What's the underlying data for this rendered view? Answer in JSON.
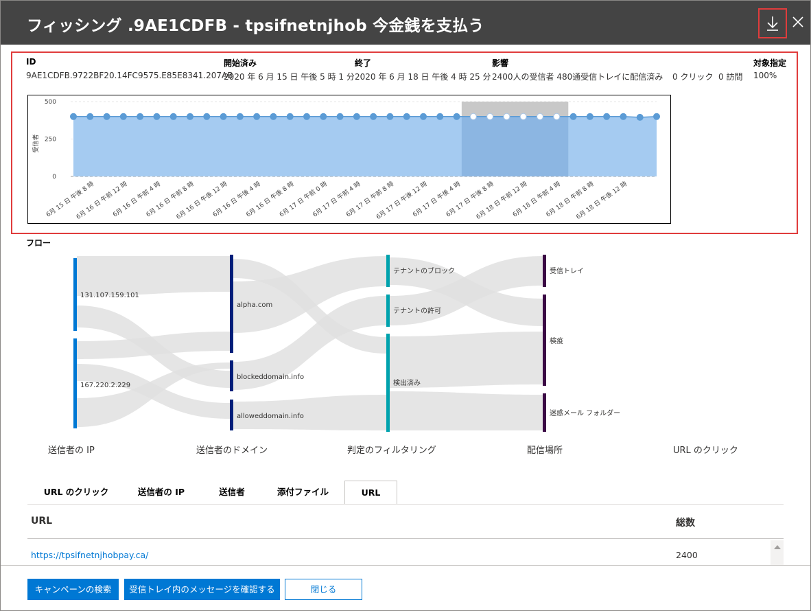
{
  "header": {
    "title": "フィッシング .9AE1CDFB - tpsifnetnjhob 今金銭を支払う",
    "download_icon": "download-icon",
    "close_icon": "close-icon"
  },
  "details": {
    "id_label": "ID",
    "id_value": "9AE1CDFB.9722BF20.14FC9575.E85E8341.207AB",
    "start_label": "開始済み",
    "start_value": "2020 年 6 月 15 日 午後 5 時 1 分",
    "end_label": "終了",
    "end_value": "2020 年 6 月 18 日 午後 4 時 25 分",
    "impact_label": "影響",
    "impact_value": "2400人の受信者 480通受信トレイに配信済み",
    "clicks_value": "0 クリック",
    "visits_value": "0 訪問",
    "targeting_label": "対象指定",
    "targeting_value": "100%"
  },
  "chart_data": {
    "type": "area",
    "ylabel": "受信者",
    "xlabel": "",
    "ylim": [
      0,
      500
    ],
    "yticks": [
      0,
      250,
      500
    ],
    "x_tick_labels": [
      "6月 15 日 午後 8 時",
      "6月 16 日 午前 12 時",
      "6月 16 日 午前 4 時",
      "6月 16 日 午前 8 時",
      "6月 16 日 午後 12 時",
      "6月 16 日 午後 4 時",
      "6月 16 日 午後 8 時",
      "6月 17 日 午前 0 時",
      "6月 17 日 午前 4 時",
      "6月 17 日 午前 8 時",
      "6月 17 日 午後 12 時",
      "6月 17 日 午後 4 時",
      "6月 17 日 午後 8 時",
      "6月 18 日 午前 12 時",
      "6月 18 日 午前 4 時",
      "6月 18 日 午前 8 時",
      "6月 18 日 午後 12 時"
    ],
    "values": [
      400,
      400,
      400,
      400,
      400,
      400,
      400,
      400,
      400,
      400,
      400,
      400,
      400,
      400,
      400,
      400,
      400,
      400,
      400,
      400,
      400,
      400,
      400,
      400,
      400,
      400,
      400,
      400,
      400,
      400,
      400,
      400,
      400,
      400,
      395,
      400
    ],
    "highlight_range": [
      24,
      29
    ],
    "grid": true,
    "colors": {
      "area": "#a0c8f0",
      "line": "#5b9bd5",
      "highlight": "#c8c8c8"
    }
  },
  "flow": {
    "title": "フロー",
    "stages": [
      "送信者の IP",
      "送信者のドメイン",
      "判定のフィルタリング",
      "配信場所",
      "URL のクリック"
    ],
    "nodes": {
      "ip1": "131.107.159.101",
      "ip2": "167.220.2.229",
      "alpha": "alpha.com",
      "blocked": "blockeddomain.info",
      "allowed": "alloweddomain.info",
      "tenant_block": "テナントのブロック",
      "tenant_allow": "テナントの許可",
      "detected": "検出済み",
      "inbox": "受信トレイ",
      "quarantine": "検疫",
      "junk": "迷惑メール フォルダー"
    },
    "colors": {
      "ip": "#0078d4",
      "domain": "#001f7a",
      "verdict": "#00a2ad",
      "location": "#3b0a45",
      "link": "#e1e1e1"
    }
  },
  "tabs": [
    {
      "label": "URL のクリック",
      "active": false
    },
    {
      "label": "送信者の IP",
      "active": false
    },
    {
      "label": "送信者",
      "active": false
    },
    {
      "label": "添付ファイル",
      "active": false
    },
    {
      "label": "URL",
      "active": true
    }
  ],
  "table": {
    "col_url": "URL",
    "col_count": "総数",
    "rows": [
      {
        "url": "https://tpsifnetnjhobpay.ca/",
        "count": "2400"
      }
    ]
  },
  "footer": {
    "search_campaign": "キャンペーンの検索",
    "check_inbox": "受信トレイ内のメッセージを確認する",
    "close": "閉じる"
  }
}
